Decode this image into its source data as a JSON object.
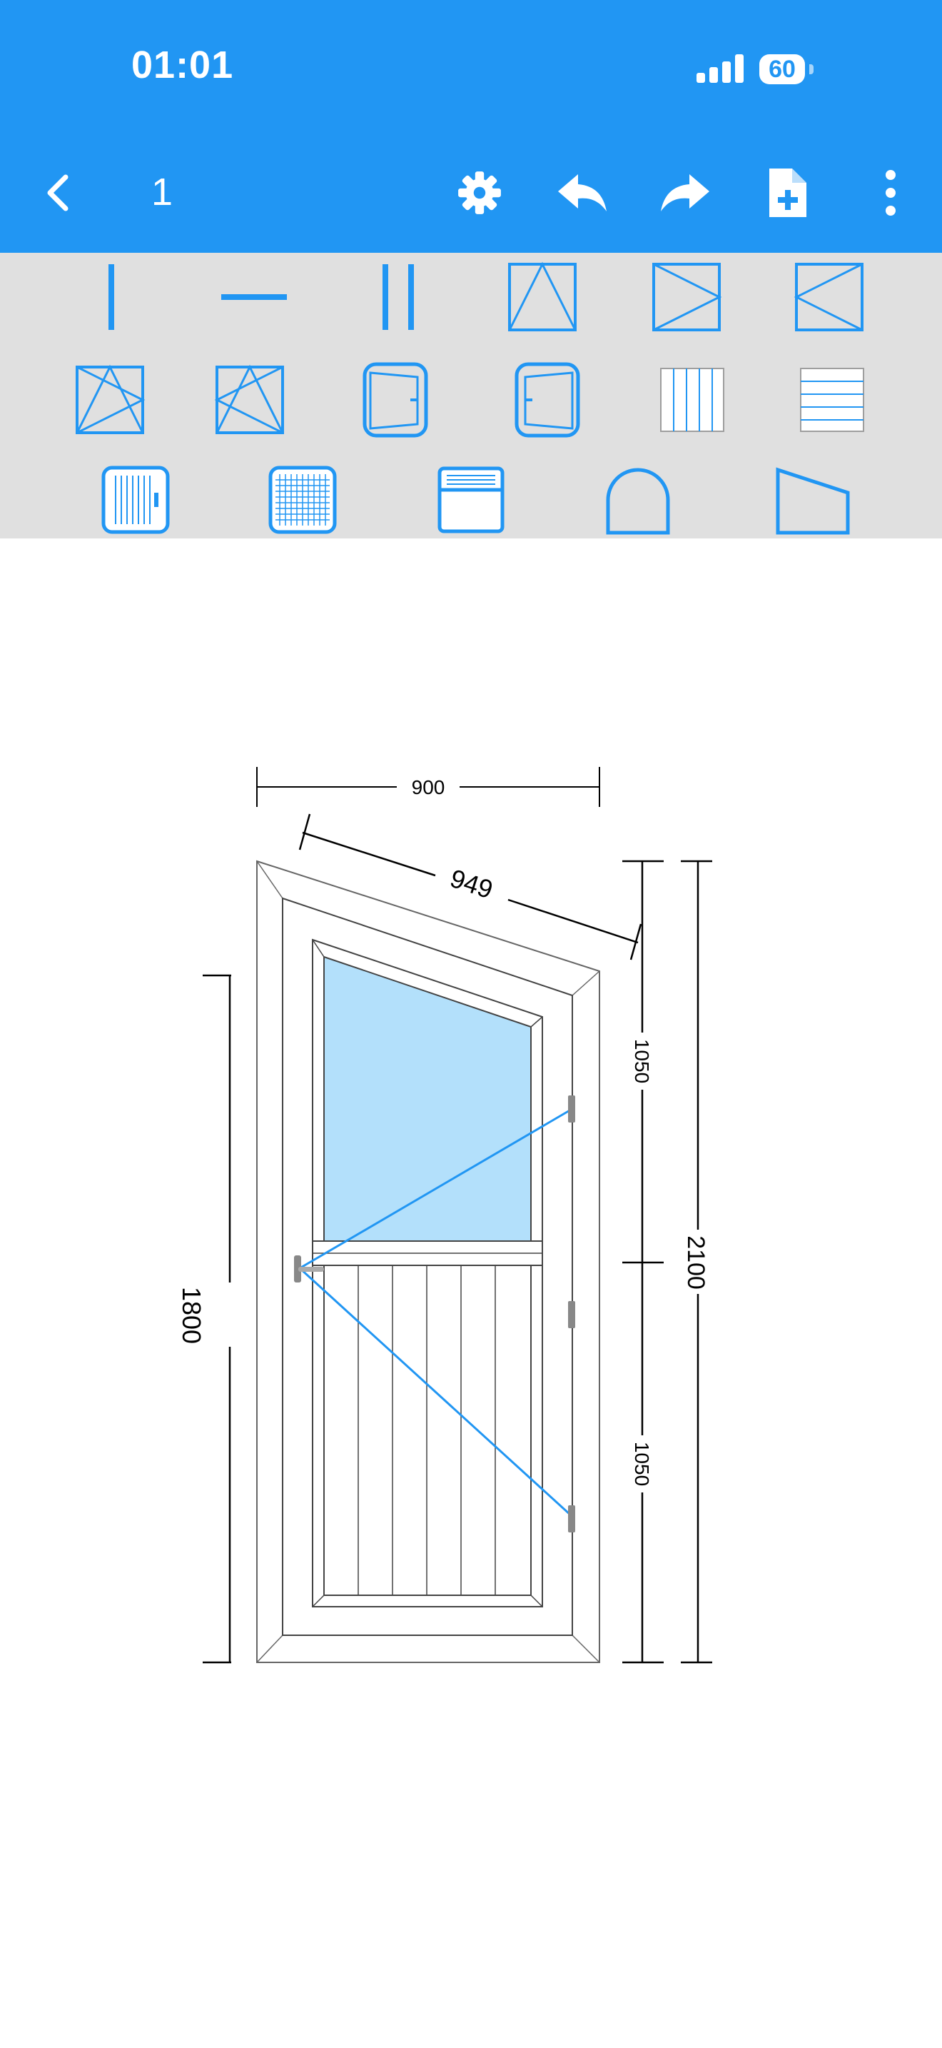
{
  "status_bar": {
    "time": "01:01",
    "battery": "60"
  },
  "toolbar": {
    "page_number": "1",
    "icons": [
      "back-icon",
      "settings-icon",
      "undo-icon",
      "redo-icon",
      "new-document-icon",
      "more-vert-icon"
    ]
  },
  "palette": {
    "rows": [
      [
        "vertical-mullion",
        "horizontal-transom",
        "double-mullion",
        "tilt-sash",
        "sash-left-hinge",
        "sash-right-hinge"
      ],
      [
        "tilt-turn-left",
        "tilt-turn-right",
        "door-right",
        "door-left",
        "vertical-panels",
        "horizontal-panels"
      ],
      [
        "shutter",
        "mosquito-net",
        "roller-box",
        "arch-top",
        "slanted-top"
      ]
    ]
  },
  "drawing": {
    "width_top": "900",
    "slant_length": "949",
    "height_left": "1800",
    "segment_upper": "1050",
    "segment_lower": "1050",
    "height_total": "2100"
  },
  "colors": {
    "primary": "#2196F3",
    "palette_bg": "#E0E0E0",
    "glass": "#B3E0FB",
    "opening_line": "#2196F3"
  }
}
